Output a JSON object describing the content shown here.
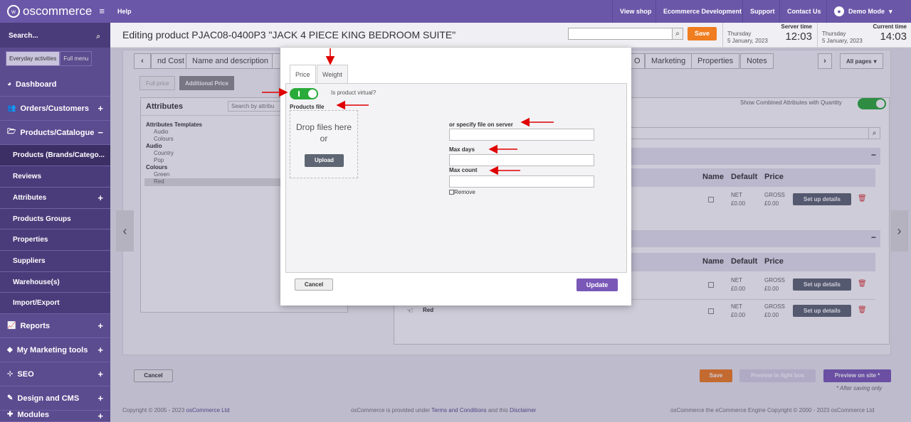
{
  "app": {
    "logo_text": "oscommerce",
    "logo_mark": "w"
  },
  "sidebar": {
    "search_placeholder": "Search...",
    "tabs": [
      "Everyday activities",
      "Full menu"
    ],
    "items": [
      {
        "label": "Dashboard",
        "icon": "dashboard-icon"
      },
      {
        "label": "Orders/Customers",
        "icon": "users-icon"
      },
      {
        "label": "Products/Catalogue",
        "icon": "folder-icon"
      },
      {
        "label": "Products (Brands/Catego...",
        "sub": true
      },
      {
        "label": "Reviews",
        "sub": true
      },
      {
        "label": "Attributes",
        "sub": true
      },
      {
        "label": "Products Groups",
        "sub": true
      },
      {
        "label": "Properties",
        "sub": true
      },
      {
        "label": "Suppliers",
        "sub": true
      },
      {
        "label": "Warehouse(s)",
        "sub": true
      },
      {
        "label": "Import/Export",
        "sub": true
      },
      {
        "label": "Reports",
        "icon": "chart-icon"
      },
      {
        "label": "My Marketing tools",
        "icon": "tag-icon"
      },
      {
        "label": "SEO",
        "icon": "sitemap-icon"
      },
      {
        "label": "Design and CMS",
        "icon": "brush-icon"
      },
      {
        "label": "Modules",
        "icon": "puzzle-icon"
      }
    ]
  },
  "topbar": {
    "help": "Help",
    "links": [
      "View shop",
      "Ecommerce Development",
      "Support",
      "Contact Us"
    ],
    "user": "Demo Mode"
  },
  "header": {
    "title": "Editing product PJAC08-0400P3 \"JACK 4 PIECE KING BEDROOM SUITE\"",
    "save": "Save",
    "server_time_label": "Server time",
    "server_day": "Thursday",
    "server_date": "5 January, 2023",
    "server_time": "12:03",
    "current_time_label": "Current time",
    "current_day": "Thursday",
    "current_date": "5 January, 2023",
    "current_time": "14:03"
  },
  "bg": {
    "tabs": [
      "nd Cost",
      "Name and description",
      "O",
      "Marketing",
      "Properties",
      "Notes"
    ],
    "all_pages": "All pages",
    "price_tabs": [
      "Full price",
      "Additional Price"
    ],
    "attributes_title": "Attributes",
    "attr_search_placeholder": "Search by attribu",
    "attr_tree": [
      "Attributes Templates",
      "Audio",
      "Colours",
      "Audio",
      "Country",
      "Pop",
      "Colours",
      "Green",
      "Red"
    ],
    "show_combined": "Show Combined Attributes with Quantity",
    "col_name": "Name",
    "col_default": "Default",
    "col_price": "Price",
    "net": "NET",
    "gross": "GROSS",
    "price_val": "£0.00",
    "setup": "Set up details",
    "red_label": "Red",
    "cancel": "Cancel",
    "save": "Save",
    "preview_light": "Preview in light box",
    "preview_site": "Preview on site *",
    "after_saving": "* After saving only",
    "footer_left": "Copyright © 2005 - 2023 ",
    "footer_left_link": "osCommerce Ltd",
    "footer_mid_a": "osCommerce is provided under ",
    "footer_mid_link1": "Terms and Conditions",
    "footer_mid_b": " and this ",
    "footer_mid_link2": "Disclaimer",
    "footer_right": "osCommerce the eCommerce Engine Copyright © 2000 - 2023 osCommerce Ltd"
  },
  "modal": {
    "tabs": [
      "Price",
      "Weight"
    ],
    "virtual_label": "Is product virtual?",
    "virtual_on": true,
    "products_file": "Products file",
    "drop_text": "Drop files here",
    "or_text": "or",
    "upload": "Upload",
    "specify_label": "or specify file on server",
    "max_days_label": "Max days",
    "max_count_label": "Max count",
    "remove_label": "Remove",
    "cancel": "Cancel",
    "update": "Update"
  },
  "colors": {
    "brand": "#6b57a8",
    "accent": "#f07d1f",
    "toggle_on": "#2aab39",
    "arrow": "#e00000"
  }
}
